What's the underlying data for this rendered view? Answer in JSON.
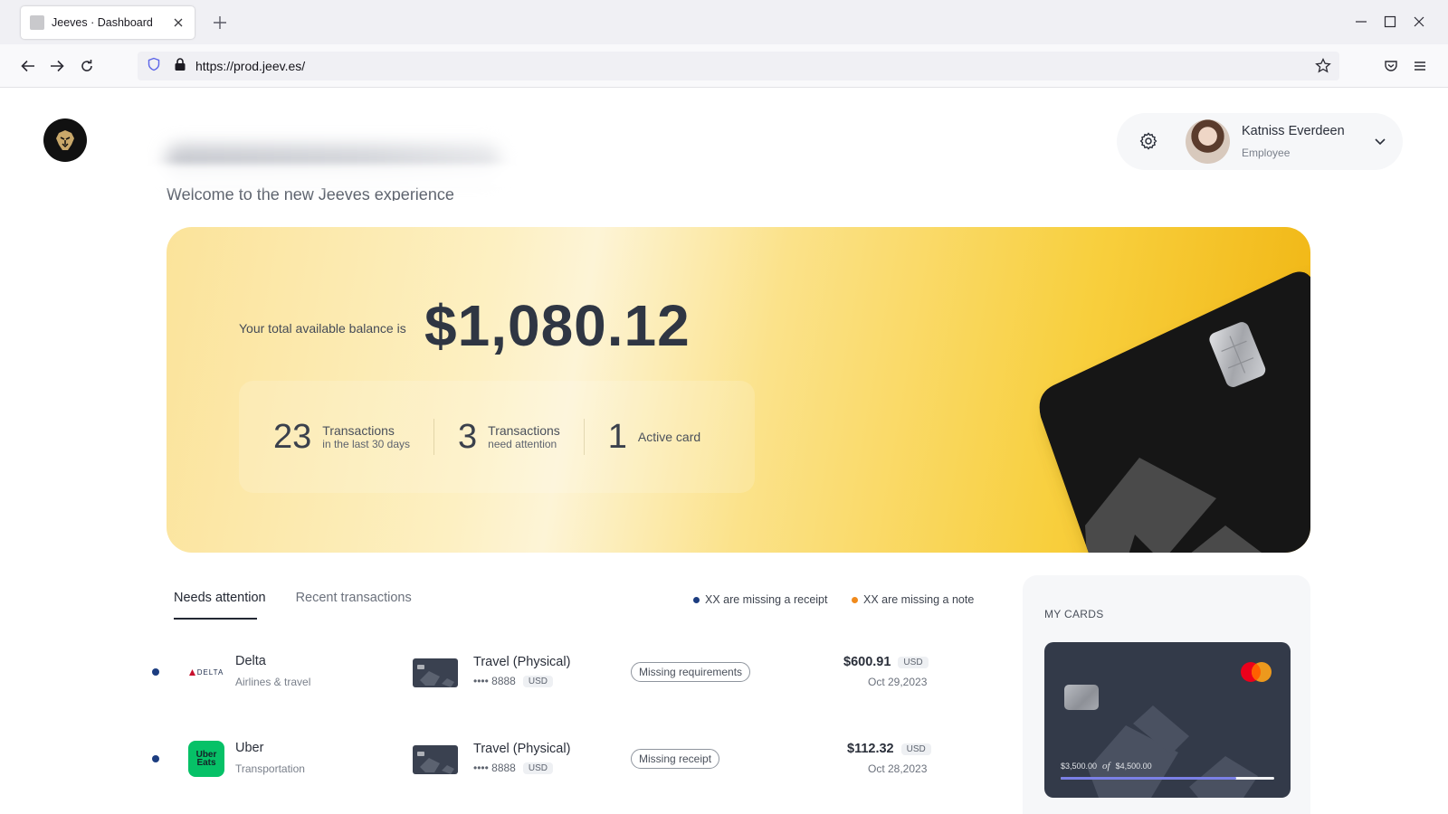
{
  "browser": {
    "tab_title": "Jeeves · Dashboard",
    "url": "https://prod.jeev.es/"
  },
  "header": {
    "welcome": "Welcome to the new Jeeves experience",
    "user_name": "Katniss Everdeen",
    "user_role": "Employee"
  },
  "hero": {
    "balance_label": "Your total available balance is",
    "balance_amount": "$1,080.12",
    "stats": [
      {
        "value": "23",
        "line1": "Transactions",
        "line2": "in the last 30 days"
      },
      {
        "value": "3",
        "line1": "Transactions",
        "line2": "need attention"
      },
      {
        "value": "1",
        "line1": "Active card",
        "line2": ""
      }
    ]
  },
  "tabs": {
    "needs_attention": "Needs attention",
    "recent_transactions": "Recent transactions"
  },
  "legend": {
    "missing_receipt": "XX are missing a receipt",
    "missing_note": "XX are missing a note"
  },
  "transactions": [
    {
      "merchant": "Delta",
      "merchant_logo_text": "DELTA",
      "category": "Airlines & travel",
      "card_name": "Travel (Physical)",
      "card_last4": "•••• 8888",
      "card_currency": "USD",
      "status": "Missing requirements",
      "amount": "$600.91",
      "currency": "USD",
      "date": "Oct 29,2023"
    },
    {
      "merchant": "Uber",
      "merchant_logo_text": "Uber Eats",
      "category": "Transportation",
      "card_name": "Travel (Physical)",
      "card_last4": "•••• 8888",
      "card_currency": "USD",
      "status": "Missing receipt",
      "amount": "$112.32",
      "currency": "USD",
      "date": "Oct 28,2023"
    }
  ],
  "my_cards": {
    "title": "MY CARDS",
    "spent": "$3,500.00",
    "of": "of",
    "limit": "$4,500.00",
    "progress_fraction": 0.82
  },
  "colors": {
    "receipt_dot": "#1c3d80",
    "note_dot": "#f08a1c",
    "uber_green": "#06c167",
    "limit_bar": "#7b80e6"
  }
}
